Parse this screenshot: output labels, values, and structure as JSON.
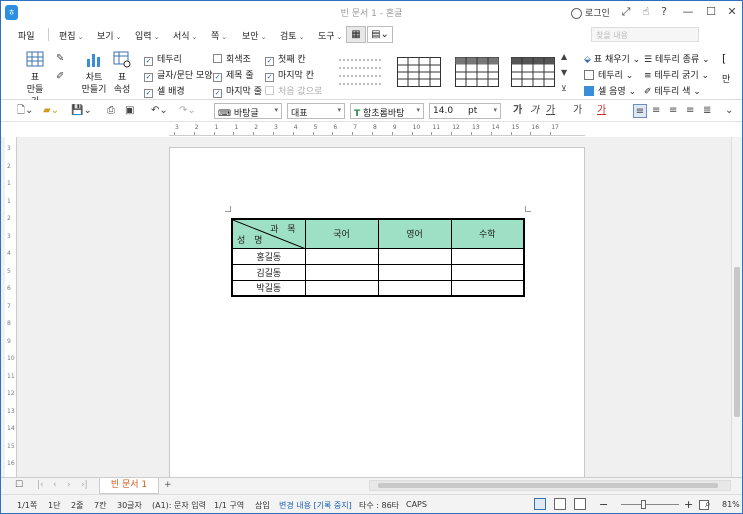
{
  "window": {
    "title": "빈 문서 1 - 혼글",
    "login": "로그인"
  },
  "menu": {
    "file": "파일",
    "edit": "편집",
    "view": "보기",
    "input": "입력",
    "format": "서식",
    "page": "쪽",
    "security": "보안",
    "review": "검토",
    "tools": "도구",
    "search_placeholder": "찾을 내용"
  },
  "ribbon": {
    "table_btn": "표",
    "table_btn2": "만들기",
    "chart_btn": "차트",
    "chart_btn2": "만들기",
    "props_btn": "표",
    "props_btn2": "속성",
    "checks": {
      "border": "테두리",
      "char_para_shape": "글자/문단 모양",
      "cell_bg": "셀 배경",
      "gray": "회색조",
      "title_row": "제목 줄",
      "last_row": "마지막 줄",
      "first_col": "첫째 칸",
      "last_col": "마지막 칸",
      "default_values": "처음 값으로"
    },
    "fill": "표 채우기",
    "borders": "테두리",
    "cell_color": "셀 음영",
    "border_type": "테두리 종류",
    "border_width": "테두리 굵기",
    "border_color": "테두리 색",
    "right_btn": "만"
  },
  "toolbar": {
    "style": "바탕글",
    "represent": "대표",
    "font": "함초롬바탕",
    "font_icon": "T",
    "size": "14.0",
    "unit": "pt",
    "ga1": "가",
    "ga2": "가",
    "ga3": "가",
    "ga4": "가",
    "ga5": "가"
  },
  "ruler": {
    "marks": [
      "3",
      "2",
      "1",
      "1",
      "2",
      "3",
      "4",
      "5",
      "6",
      "7",
      "8",
      "9",
      "10",
      "11",
      "12",
      "13",
      "14",
      "15",
      "16",
      "17"
    ]
  },
  "vruler": {
    "marks": [
      "3",
      "2",
      "1",
      "1",
      "2",
      "3",
      "4",
      "5",
      "6",
      "7",
      "8",
      "9",
      "10",
      "11",
      "12",
      "13",
      "14",
      "15",
      "16"
    ]
  },
  "table": {
    "diag_top": "과 목",
    "diag_bottom": "성 명",
    "headers": [
      "국어",
      "영어",
      "수학"
    ],
    "rows": [
      "홍길동",
      "김길동",
      "박길동"
    ],
    "header_color": "#9ee0c6"
  },
  "tabs": {
    "doc": "빈 문서 1",
    "add": "+"
  },
  "status": {
    "page": "1/1쪽",
    "section": "1단",
    "line": "2줄",
    "col": "7칸",
    "chars": "30글자",
    "cell": "(A1): 문자 입력",
    "area": "1/1 구역",
    "insert": "삽입",
    "track": "변경 내용 [기록 중지]",
    "typing": "타수 : 86타",
    "caps": "CAPS",
    "zoom": "81%"
  }
}
